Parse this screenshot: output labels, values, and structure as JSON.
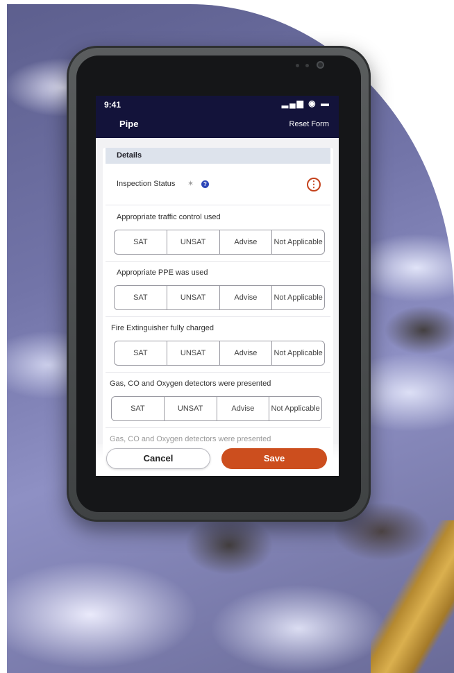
{
  "status_bar": {
    "time": "9:41",
    "icons": "▂▄▆ ◉ ▬"
  },
  "header": {
    "title": "Pipe",
    "reset_label": "Reset Form"
  },
  "details": {
    "section_title": "Details",
    "inspection_status_label": "Inspection Status",
    "wand_glyph": "✶",
    "help_glyph": "?",
    "more_glyph": "⋮"
  },
  "questions": [
    {
      "label": "Appropriate traffic control used",
      "options": [
        "SAT",
        "UNSAT",
        "Advise",
        "Not Applicable"
      ]
    },
    {
      "label": "Appropriate PPE was used",
      "options": [
        "SAT",
        "UNSAT",
        "Advise",
        "Not Applicable"
      ]
    },
    {
      "label": "Fire Extinguisher fully charged",
      "options": [
        "SAT",
        "UNSAT",
        "Advise",
        "Not Applicable"
      ]
    },
    {
      "label": "Gas, CO and Oxygen detectors were presented",
      "options": [
        "SAT",
        "UNSAT",
        "Advise",
        "Not Applicable"
      ]
    },
    {
      "label": "Gas, CO and Oxygen detectors were presented"
    }
  ],
  "actions": {
    "cancel_label": "Cancel",
    "save_label": "Save"
  },
  "colors": {
    "header_bg": "#13133a",
    "accent": "#cc4e1e",
    "help": "#2c46b8"
  }
}
